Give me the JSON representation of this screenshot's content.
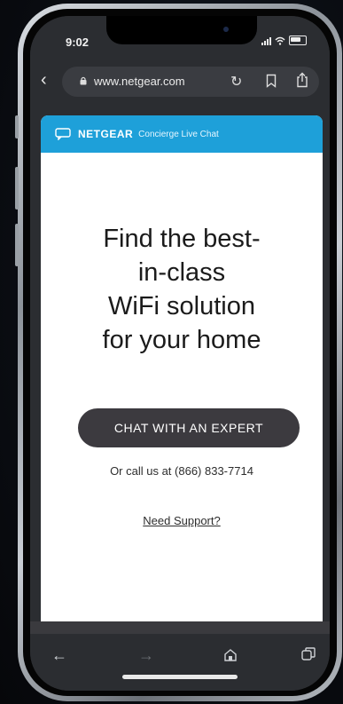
{
  "status_bar": {
    "time": "9:02"
  },
  "browser": {
    "url": "www.netgear.com",
    "icons": {
      "back": "chevron-left-icon",
      "lock": "lock-icon",
      "reload": "reload-icon",
      "bookmark": "bookmark-icon",
      "share": "share-icon"
    }
  },
  "chat_widget": {
    "brand": "NETGEAR",
    "subtitle": "Concierge Live Chat",
    "header_color": "#1ea0d9",
    "headline_lines": [
      "Find the best-",
      "in-class",
      "WiFi solution",
      "for your home"
    ],
    "button_label": "CHAT WITH AN EXPERT",
    "call_text": "Or call us at (866) 833-7714",
    "support_link": "Need Support?"
  },
  "toolbar": {
    "icons": [
      "back-arrow-icon",
      "forward-arrow-icon",
      "home-icon",
      "tabs-icon"
    ]
  },
  "glyphs": {
    "back": "‹",
    "reload": "↻",
    "toolbar_back": "←",
    "toolbar_forward": "→"
  }
}
